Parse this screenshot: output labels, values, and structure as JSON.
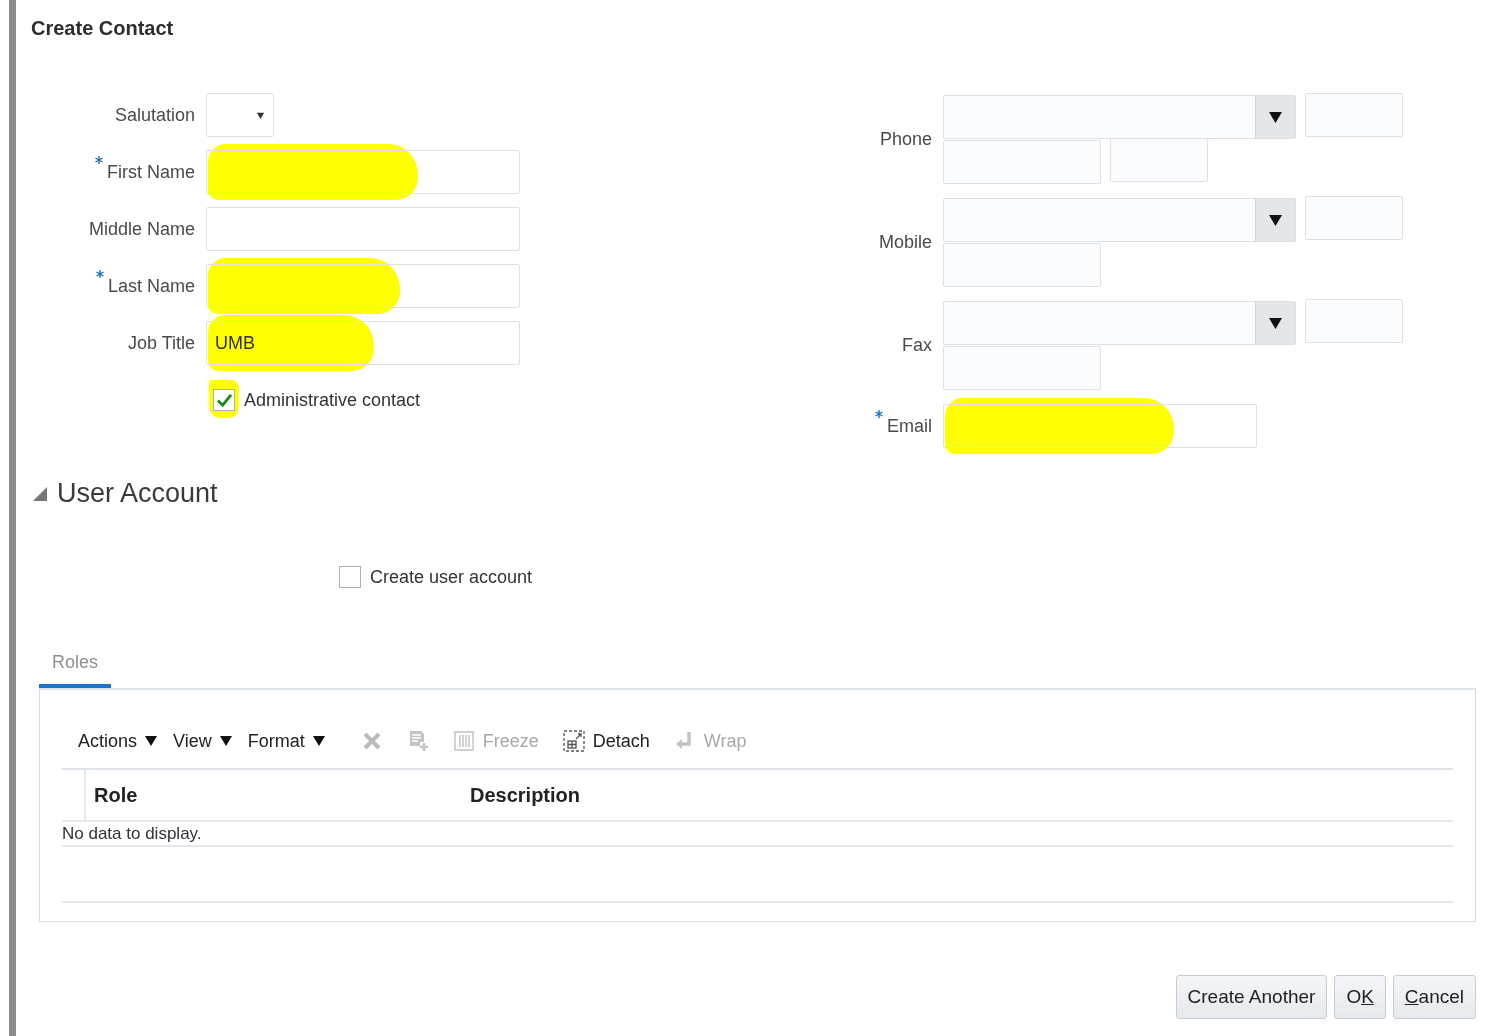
{
  "window": {
    "title": "Create Contact"
  },
  "left_fields": [
    {
      "label": "Salutation",
      "required": false,
      "kind": "select",
      "highlighted": false
    },
    {
      "label": "First Name",
      "required": true,
      "kind": "text",
      "highlighted": true
    },
    {
      "label": "Middle Name",
      "required": false,
      "kind": "text",
      "highlighted": false
    },
    {
      "label": "Last Name",
      "required": true,
      "kind": "text",
      "highlighted": true
    },
    {
      "label": "Job Title",
      "required": false,
      "kind": "text",
      "value": "UMB",
      "highlighted": true
    }
  ],
  "admin_checkbox": {
    "label": "Administrative contact",
    "checked": true,
    "highlighted": true
  },
  "contact_fields": [
    {
      "label": "Phone",
      "required": false,
      "rows": [
        [
          {
            "kind": "select"
          },
          {
            "kind": "short"
          }
        ],
        [
          {
            "kind": "medium"
          },
          {
            "kind": "short"
          }
        ]
      ]
    },
    {
      "label": "Mobile",
      "required": false,
      "rows": [
        [
          {
            "kind": "select"
          },
          {
            "kind": "short"
          }
        ],
        [
          {
            "kind": "medium"
          }
        ]
      ]
    },
    {
      "label": "Fax",
      "required": false,
      "rows": [
        [
          {
            "kind": "select"
          },
          {
            "kind": "short"
          }
        ],
        [
          {
            "kind": "medium"
          }
        ]
      ]
    },
    {
      "label": "Email",
      "required": true,
      "rows": [
        [
          {
            "kind": "wide",
            "highlighted": true
          }
        ]
      ]
    }
  ],
  "user_account": {
    "title": "User Account",
    "expanded": true,
    "checkbox": {
      "label": "Create user account",
      "checked": false
    }
  },
  "tabs": [
    {
      "label": "Roles",
      "selected": true
    }
  ],
  "toolbar": [
    {
      "kind": "menu",
      "label": "Actions",
      "disabled": false
    },
    {
      "kind": "menu",
      "label": "View",
      "disabled": false
    },
    {
      "kind": "menu",
      "label": "Format",
      "disabled": false
    },
    {
      "kind": "delete",
      "disabled": true
    },
    {
      "kind": "add-row",
      "disabled": true
    },
    {
      "kind": "freeze",
      "label": "Freeze",
      "disabled": true
    },
    {
      "kind": "detach",
      "label": "Detach",
      "disabled": false
    },
    {
      "kind": "wrap",
      "label": "Wrap",
      "disabled": true
    }
  ],
  "table": {
    "columns": [
      "Role",
      "Description"
    ],
    "empty_text": "No data to display."
  },
  "buttons": [
    {
      "before": "Create Another"
    },
    {
      "before": "O",
      "key": "K"
    },
    {
      "key": "C",
      "after": "ancel"
    }
  ]
}
